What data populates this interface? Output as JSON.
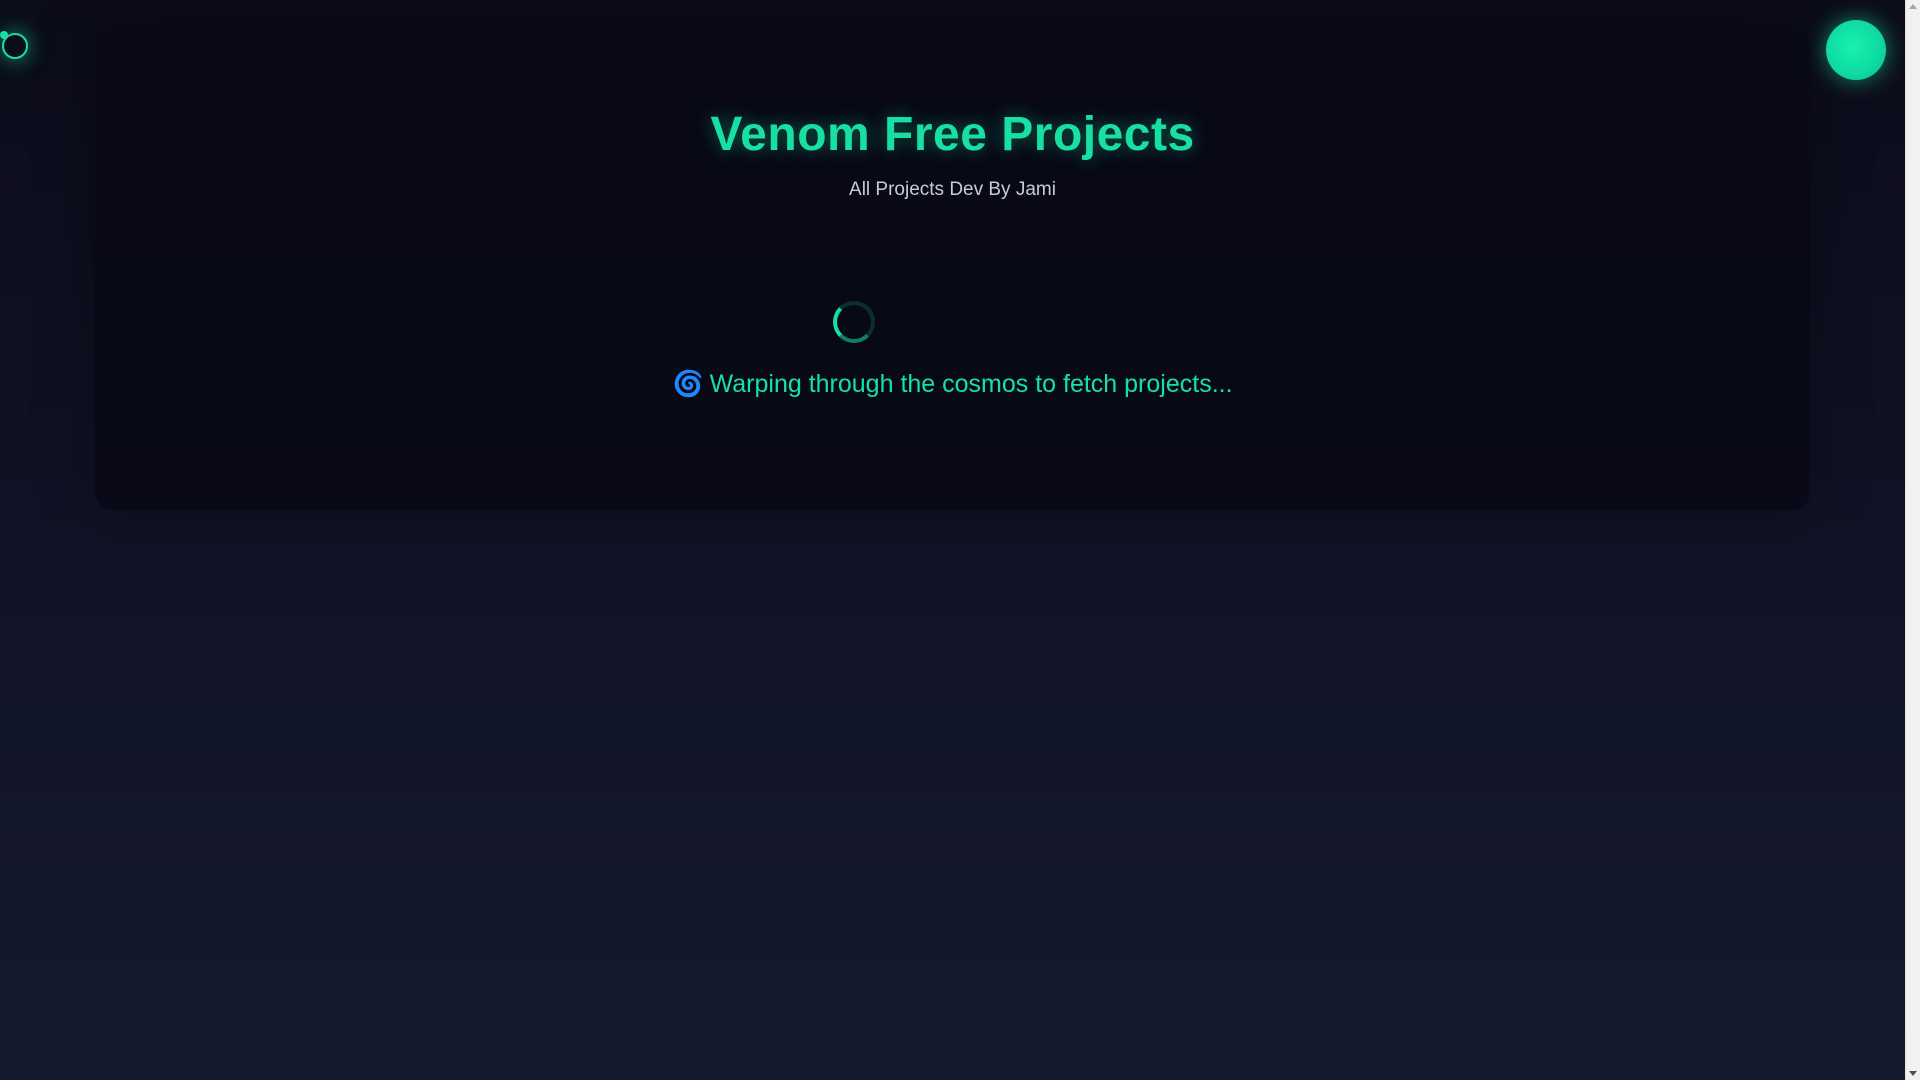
{
  "header": {
    "title": "Venom Free Projects",
    "subtitle": "All Projects Dev By Jami"
  },
  "loading": {
    "emoji": "🌀",
    "message": "Warping through the cosmos to fetch projects..."
  },
  "icons": {
    "spinner": "loading-spinner-icon",
    "cursor": "cursor-ring-icon",
    "orb": "glowing-orb-icon",
    "scroll_up": "chevron-up-icon",
    "scroll_down": "chevron-down-icon"
  },
  "colors": {
    "accent": "#18e0a2",
    "background": "#0c0c1a",
    "panel": "#080816",
    "subtitle_text": "#c9cbd6"
  }
}
